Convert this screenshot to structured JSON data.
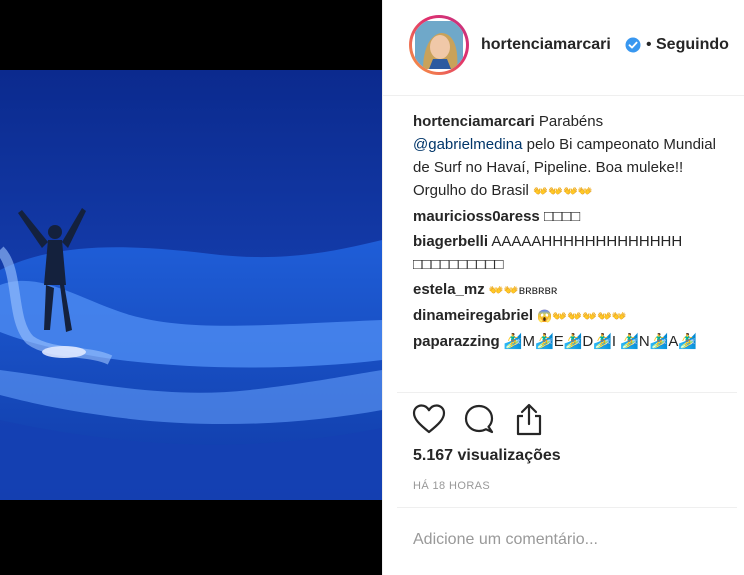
{
  "post": {
    "author": "hortenciamarcari",
    "follow_separator": "•",
    "follow_state": "Seguindo"
  },
  "caption": {
    "user": "hortenciamarcari",
    "text_before": "Parabéns",
    "mention": "@gabrielmedina",
    "text_after": "pelo Bi campeonato Mundial de Surf no Havaí, Pipeline. Boa muleke!! Orgulho do Brasil",
    "emoji": "👐👐👐👐"
  },
  "comments": [
    {
      "user": "mauricioss0aress",
      "text": "□□□□"
    },
    {
      "user": "biagerbelli",
      "text": "AAAAAHHHHHHHHHHHHH □□□□□□□□□□"
    },
    {
      "user": "estela_mz",
      "text": "👐👐ʙʀʙʀʙʀ"
    },
    {
      "user": "dinameiregabriel",
      "text": "😱👐👐👐👐👐"
    },
    {
      "user": "paparazzing",
      "text": "🏄‍♂M🏄‍♂E🏄‍♂D🏄‍♂I 🏄‍♂N🏄‍♂A🏄‍♂"
    }
  ],
  "stats": {
    "views": "5.167 visualizações",
    "time": "HÁ 18 HORAS"
  },
  "add_comment": {
    "placeholder": "Adicione um comentário..."
  },
  "icons": {
    "like": "heart-icon",
    "comment": "comment-icon",
    "share": "share-icon",
    "verified": "verified-badge-icon"
  },
  "colors": {
    "verified": "#3897f0",
    "mention": "#003569",
    "text": "#262626",
    "muted": "#999999"
  }
}
